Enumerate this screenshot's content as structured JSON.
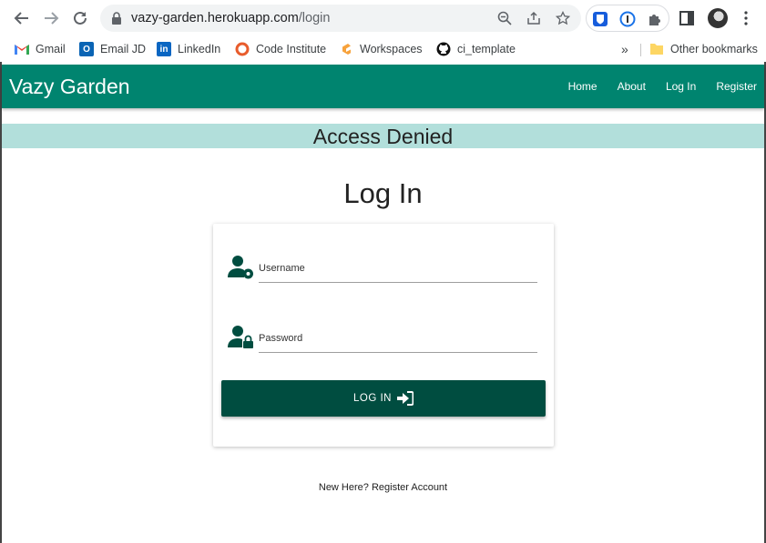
{
  "browser": {
    "url_host": "vazy-garden.herokuapp.com",
    "url_path": "/login",
    "bookmarks": [
      "Gmail",
      "Email JD",
      "LinkedIn",
      "Code Institute",
      "Workspaces",
      "ci_template"
    ],
    "overflow": "»",
    "other_bookmarks": "Other bookmarks"
  },
  "site": {
    "brand": "Vazy Garden",
    "nav": [
      "Home",
      "About",
      "Log In",
      "Register"
    ],
    "accent": "#00846f",
    "dark": "#004d40",
    "banner_color": "#b2dfdb"
  },
  "flash": "Access Denied",
  "login": {
    "title": "Log In",
    "username_label": "Username",
    "password_label": "Password",
    "button_label": "LOG IN",
    "register_text": "New Here? Register Account"
  }
}
